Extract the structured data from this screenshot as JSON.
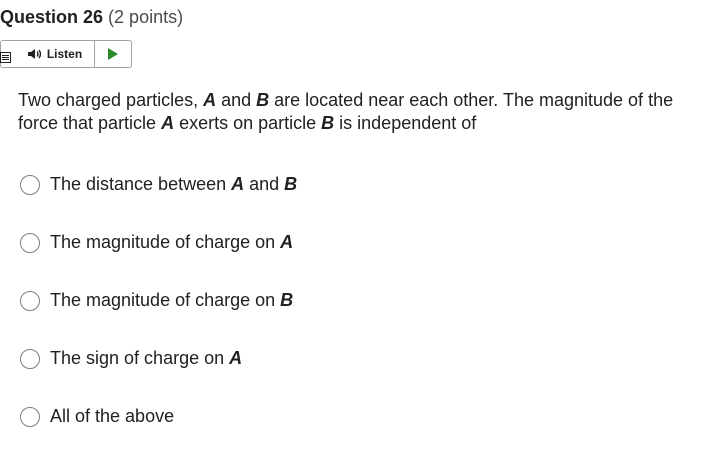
{
  "question": {
    "title": "Question 26",
    "points": "(2 points)",
    "text_parts": [
      "Two charged particles, ",
      "A",
      " and ",
      "B",
      " are located near each other. The magnitude of the force that particle ",
      "A",
      " exerts on particle ",
      "B",
      " is independent of"
    ]
  },
  "listen": {
    "label": "Listen",
    "play_icon": "play-icon",
    "speaker_icon": "speaker-icon",
    "menu_icon": "menu-icon",
    "play_color": "#2a8a2a"
  },
  "choices": [
    {
      "parts": [
        "The distance between ",
        "A",
        " and ",
        "B"
      ],
      "selected": false
    },
    {
      "parts": [
        "The magnitude of charge on ",
        "A"
      ],
      "selected": false
    },
    {
      "parts": [
        "The magnitude of charge on ",
        "B"
      ],
      "selected": false
    },
    {
      "parts": [
        "The sign of charge on ",
        "A"
      ],
      "selected": false
    },
    {
      "parts": [
        "All of the above"
      ],
      "selected": false
    }
  ]
}
